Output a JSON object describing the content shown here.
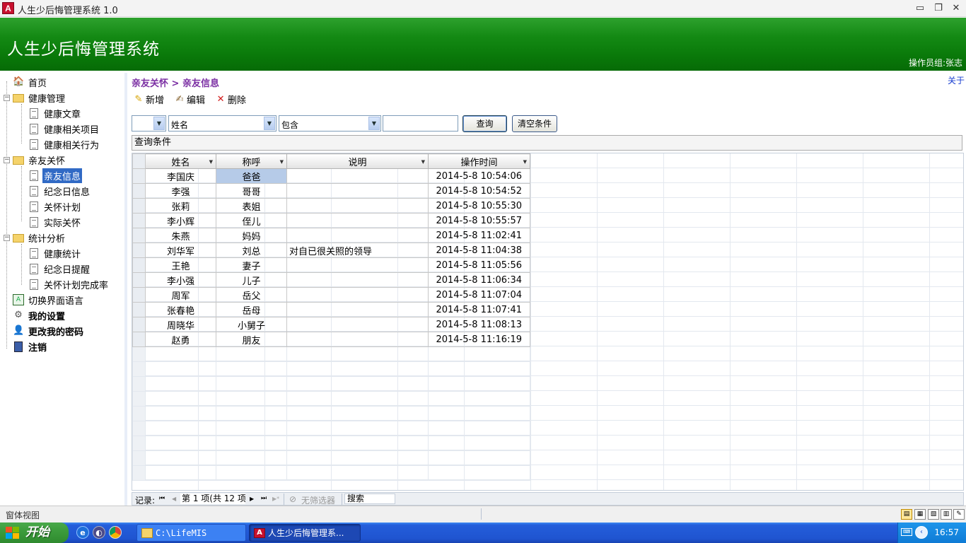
{
  "window": {
    "title": "人生少后悔管理系统 1.0",
    "app_icon_letter": "A",
    "minimize": "▭",
    "restore": "❐",
    "close": "✕"
  },
  "banner": {
    "title": "人生少后悔管理系统",
    "operator": "操作员组:张志"
  },
  "sidebar": {
    "items": [
      {
        "label": "首页"
      },
      {
        "label": "健康管理"
      },
      {
        "label": "健康文章"
      },
      {
        "label": "健康相关项目"
      },
      {
        "label": "健康相关行为"
      },
      {
        "label": "亲友关怀"
      },
      {
        "label": "亲友信息"
      },
      {
        "label": "纪念日信息"
      },
      {
        "label": "关怀计划"
      },
      {
        "label": "实际关怀"
      },
      {
        "label": "统计分析"
      },
      {
        "label": "健康统计"
      },
      {
        "label": "纪念日提醒"
      },
      {
        "label": "关怀计划完成率"
      },
      {
        "label": "切换界面语言"
      },
      {
        "label": "我的设置"
      },
      {
        "label": "更改我的密码"
      },
      {
        "label": "注销"
      }
    ],
    "expanders": [
      "−",
      "−",
      "−"
    ]
  },
  "main": {
    "breadcrumb": "亲友关怀 > 亲友信息",
    "about": "关于",
    "toolbar": {
      "new": "新增",
      "edit": "编辑",
      "delete": "删除"
    },
    "filters": {
      "field": "姓名",
      "operator": "包含",
      "value": "",
      "query_button": "查询",
      "clear_button": "清空条件"
    },
    "criteria_label": "查询条件",
    "columns": [
      "姓名",
      "称呼",
      "说明",
      "操作时间"
    ],
    "rows": [
      [
        "李国庆",
        "爸爸",
        "",
        "2014-5-8 10:54:06"
      ],
      [
        "李强",
        "哥哥",
        "",
        "2014-5-8 10:54:52"
      ],
      [
        "张莉",
        "表姐",
        "",
        "2014-5-8 10:55:30"
      ],
      [
        "李小辉",
        "侄儿",
        "",
        "2014-5-8 10:55:57"
      ],
      [
        "朱燕",
        "妈妈",
        "",
        "2014-5-8 11:02:41"
      ],
      [
        "刘华军",
        "刘总",
        "对自已很关照的领导",
        "2014-5-8 11:04:38"
      ],
      [
        "王艳",
        "妻子",
        "",
        "2014-5-8 11:05:56"
      ],
      [
        "李小强",
        "儿子",
        "",
        "2014-5-8 11:06:34"
      ],
      [
        "周军",
        "岳父",
        "",
        "2014-5-8 11:07:04"
      ],
      [
        "张春艳",
        "岳母",
        "",
        "2014-5-8 11:07:41"
      ],
      [
        "周晓华",
        "小舅子",
        "",
        "2014-5-8 11:08:13"
      ],
      [
        "赵勇",
        "朋友",
        "",
        "2014-5-8 11:16:19"
      ]
    ],
    "navigator": {
      "label": "记录:",
      "first": "⏮",
      "prev": "◀",
      "position": "第 1 项(共 12 项",
      "next": "▶",
      "last": "⏭",
      "new": "▶*",
      "filter": "无筛选器",
      "search": "搜索"
    }
  },
  "statusbar": {
    "text": "窗体视图"
  },
  "taskbar": {
    "start": "开始",
    "tasks": [
      {
        "label": "C:\\LifeMIS"
      },
      {
        "label": "人生少后悔管理系..."
      }
    ],
    "clock": "16:57"
  }
}
